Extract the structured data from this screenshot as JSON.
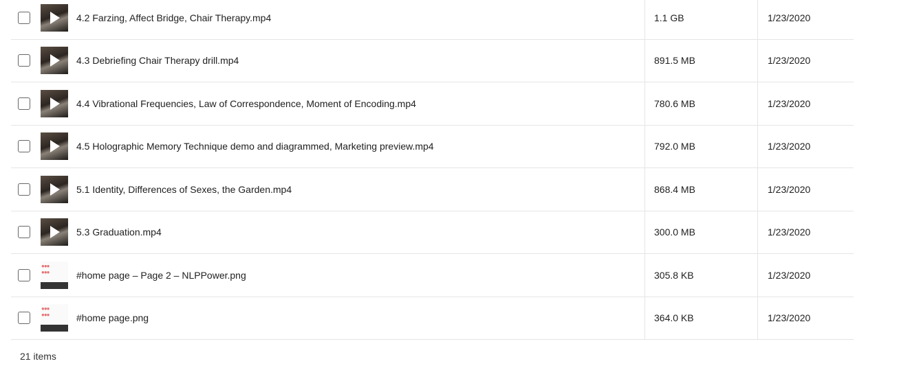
{
  "files": [
    {
      "name": "4.2 Farzing, Affect Bridge, Chair Therapy.mp4",
      "size": "1.1 GB",
      "date": "1/23/2020",
      "type": "video"
    },
    {
      "name": "4.3 Debriefing Chair Therapy drill.mp4",
      "size": "891.5 MB",
      "date": "1/23/2020",
      "type": "video"
    },
    {
      "name": "4.4 Vibrational Frequencies, Law of Correspondence, Moment of Encoding.mp4",
      "size": "780.6 MB",
      "date": "1/23/2020",
      "type": "video"
    },
    {
      "name": "4.5 Holographic Memory Technique demo and diagrammed, Marketing preview.mp4",
      "size": "792.0 MB",
      "date": "1/23/2020",
      "type": "video"
    },
    {
      "name": "5.1 Identity, Differences of Sexes, the Garden.mp4",
      "size": "868.4 MB",
      "date": "1/23/2020",
      "type": "video"
    },
    {
      "name": "5.3 Graduation.mp4",
      "size": "300.0 MB",
      "date": "1/23/2020",
      "type": "video"
    },
    {
      "name": "#home page – Page 2 – NLPPower.png",
      "size": "305.8 KB",
      "date": "1/23/2020",
      "type": "image"
    },
    {
      "name": "#home page.png",
      "size": "364.0 KB",
      "date": "1/23/2020",
      "type": "image"
    }
  ],
  "footer": {
    "item_count": "21 items"
  }
}
